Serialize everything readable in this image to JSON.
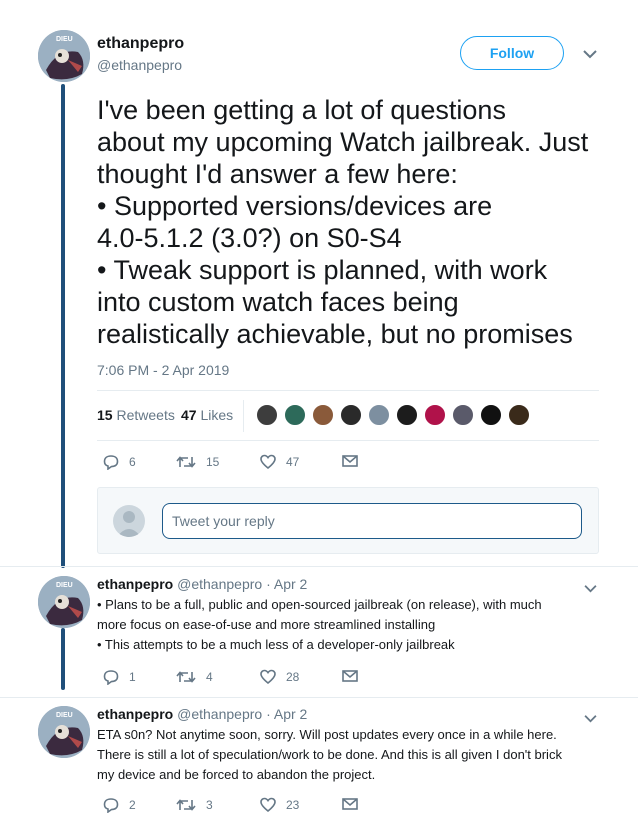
{
  "main_tweet": {
    "name": "ethanpepro",
    "handle": "@ethanpepro",
    "follow_label": "Follow",
    "text": "I've been getting a lot of questions\nabout my upcoming Watch jailbreak. Just\nthought I'd answer a few here:\n• Supported versions/devices are\n4.0-5.1.2 (3.0?) on S0-S4\n• Tweak support is planned, with work\ninto custom watch faces being\nrealistically achievable, but no promises",
    "timestamp": "7:06 PM - 2 Apr 2019",
    "retweets_count": "15",
    "retweets_label": "Retweets",
    "likes_count": "47",
    "likes_label": "Likes",
    "replies": "6",
    "retweets": "15",
    "likes": "47",
    "avatar_text": "DIEU"
  },
  "reply_box": {
    "placeholder": "Tweet your reply"
  },
  "replies": [
    {
      "name": "ethanpepro",
      "handle": "@ethanpepro",
      "date": "· Apr 2",
      "text": "• Plans to be a full, public and open-sourced jailbreak (on release), with much\nmore focus on ease-of-use and more streamlined installing\n• This attempts to be a much less of a developer-only jailbreak",
      "replies": "1",
      "retweets": "4",
      "likes": "28",
      "avatar_text": "DIEU"
    },
    {
      "name": "ethanpepro",
      "handle": "@ethanpepro",
      "date": "· Apr 2",
      "text": "ETA s0n? Not anytime soon, sorry. Will post updates every once in a while here.\nThere is still a lot of speculation/work to be done. And this is all given I don't brick\nmy device and be forced to abandon the project.",
      "replies": "2",
      "retweets": "3",
      "likes": "23",
      "avatar_text": "DIEU"
    }
  ],
  "colors": {
    "accent": "#1da1f2",
    "thread": "#1f4f7a",
    "muted": "#657786"
  }
}
